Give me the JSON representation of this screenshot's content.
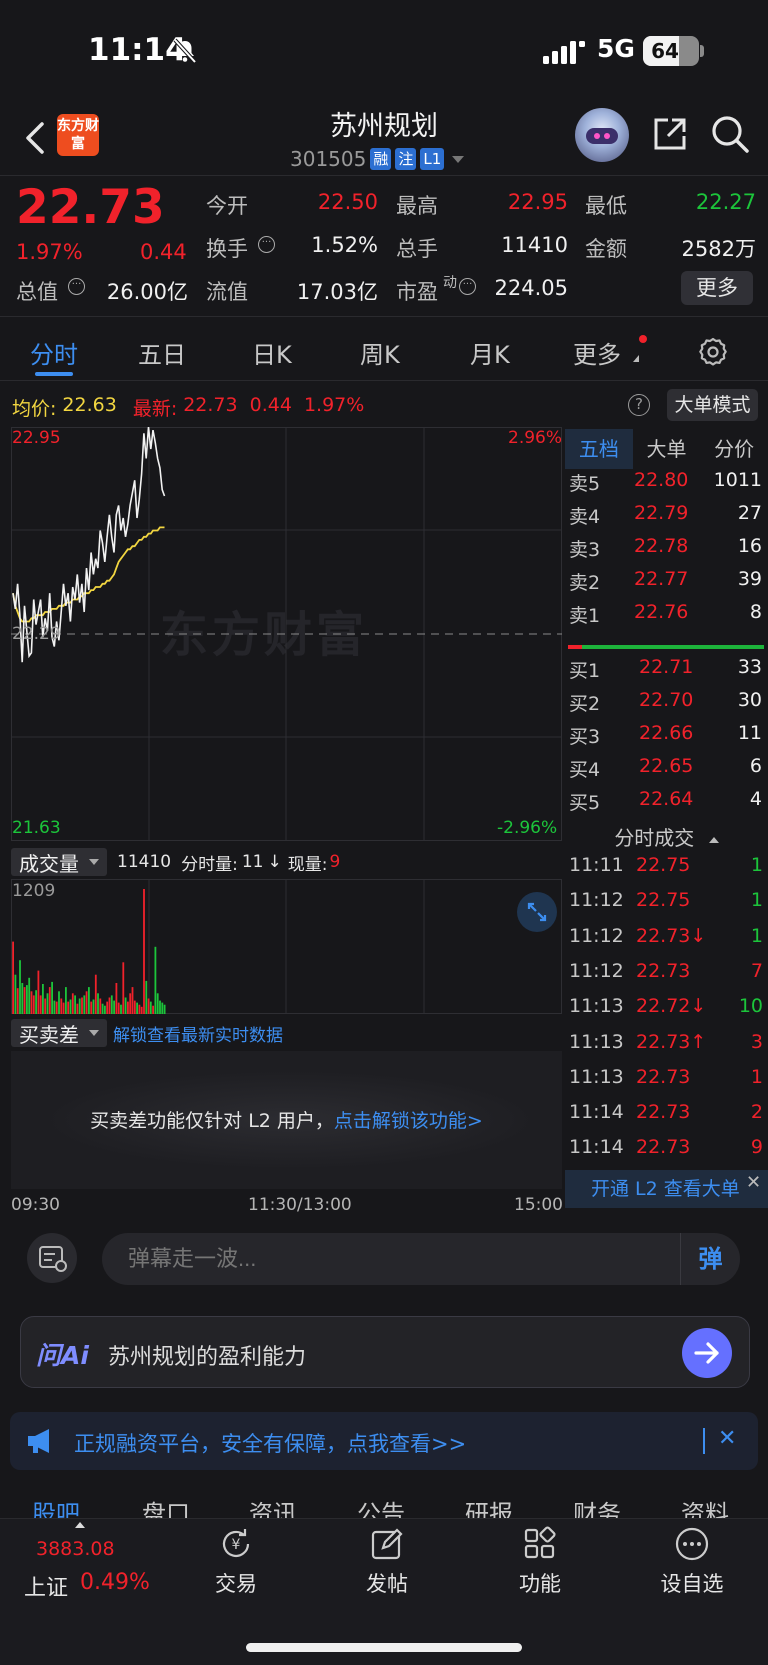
{
  "status": {
    "time": "11:14",
    "network": "5G",
    "battery": "64",
    "battery_level": 0.64
  },
  "header": {
    "logo_text": "东方财富",
    "name": "苏州规划",
    "code": "301505",
    "tags": [
      "融",
      "注",
      "L1"
    ]
  },
  "quote": {
    "price": "22.73",
    "change_pct": "1.97%",
    "change": "0.44",
    "fields": [
      {
        "k": "今开",
        "v": "22.50",
        "c": "red"
      },
      {
        "k": "最高",
        "v": "22.95",
        "c": "red"
      },
      {
        "k": "最低",
        "v": "22.27",
        "c": "green"
      },
      {
        "k": "换手",
        "v": "1.52%",
        "c": "white"
      },
      {
        "k": "总手",
        "v": "11410",
        "c": "white"
      },
      {
        "k": "金额",
        "v": "2582万",
        "c": "white"
      },
      {
        "k": "总值",
        "v": "26.00亿",
        "c": "white"
      },
      {
        "k": "流值",
        "v": "17.03亿",
        "c": "white"
      },
      {
        "k": "市盈",
        "v": "224.05",
        "c": "white"
      }
    ],
    "pe_sup": "动",
    "more": "更多"
  },
  "tabs": [
    "分时",
    "五日",
    "日K",
    "周K",
    "月K",
    "更多"
  ],
  "info": {
    "avg_label": "均价:",
    "avg": "22.63",
    "latest_label": "最新:",
    "latest": "22.73",
    "chg": "0.44",
    "pct": "1.97%",
    "big_mode": "大单模式"
  },
  "chart": {
    "watermark": "东方财富",
    "y_top": "22.95",
    "y_mid": "22.29",
    "y_bottom": "21.63",
    "pct_top": "2.96%",
    "pct_bottom": "-2.96%",
    "x_start": "09:30",
    "x_mid": "11:30/13:00",
    "x_end": "15:00"
  },
  "chart_data": {
    "type": "line",
    "series": [
      {
        "name": "最新",
        "values": [
          22.42,
          22.37,
          22.45,
          22.35,
          22.2,
          22.38,
          22.3,
          22.22,
          22.23,
          22.4,
          22.32,
          22.36,
          22.4,
          22.28,
          22.34,
          22.3,
          22.42,
          22.28,
          22.25,
          22.33,
          22.27,
          22.36,
          22.45,
          22.38,
          22.42,
          22.33,
          22.44,
          22.4,
          22.48,
          22.39,
          22.45,
          22.36,
          22.5,
          22.43,
          22.55,
          22.48,
          22.53,
          22.5,
          22.62,
          22.58,
          22.52,
          22.6,
          22.67,
          22.6,
          22.55,
          22.67,
          22.7,
          22.62,
          22.66,
          22.6,
          22.64,
          22.7,
          22.74,
          22.78,
          22.66,
          22.72,
          22.8,
          22.93,
          22.85,
          22.95,
          22.88,
          22.94,
          22.9,
          22.85,
          22.82,
          22.75,
          22.73
        ]
      },
      {
        "name": "均价",
        "values": [
          22.42,
          22.38,
          22.36,
          22.34,
          22.33,
          22.33,
          22.33,
          22.33,
          22.34,
          22.34,
          22.35,
          22.35,
          22.35,
          22.35,
          22.36,
          22.36,
          22.36,
          22.37,
          22.37,
          22.37,
          22.38,
          22.38,
          22.38,
          22.39,
          22.39,
          22.39,
          22.4,
          22.4,
          22.4,
          22.41,
          22.41,
          22.42,
          22.42,
          22.42,
          22.43,
          22.43,
          22.44,
          22.44,
          22.44,
          22.45,
          22.45,
          22.46,
          22.46,
          22.47,
          22.48,
          22.5,
          22.52,
          22.53,
          22.54,
          22.55,
          22.56,
          22.56,
          22.57,
          22.57,
          22.58,
          22.59,
          22.59,
          22.6,
          22.6,
          22.61,
          22.61,
          22.62,
          22.62,
          22.62,
          22.63,
          22.63,
          22.63
        ]
      }
    ],
    "volume": [
      700,
      380,
      250,
      520,
      300,
      260,
      280,
      350,
      220,
      180,
      230,
      420,
      180,
      290,
      150,
      200,
      260,
      310,
      130,
      120,
      220,
      150,
      110,
      260,
      120,
      140,
      200,
      180,
      100,
      150,
      160,
      180,
      220,
      260,
      120,
      140,
      380,
      200,
      150,
      100,
      80,
      120,
      160,
      180,
      130,
      300,
      110,
      90,
      500,
      160,
      120,
      200,
      260,
      130,
      110,
      90,
      70,
      1209,
      320,
      150,
      120,
      80,
      650,
      200,
      130,
      110,
      90
    ],
    "volume_colors": "mixed red/green",
    "ylim": [
      21.63,
      22.95
    ],
    "volume_max": 1209
  },
  "volume": {
    "label": "成交量",
    "total": "11410",
    "fen_label": "分时量:",
    "fen": "11",
    "arrow": "↓",
    "now_label": "现量:",
    "now": "9",
    "max": "1209"
  },
  "diff": {
    "label": "买卖差",
    "unlock": "解锁查看最新实时数据",
    "note": "买卖差功能仅针对 L2 用户，",
    "link": "点击解锁该功能>"
  },
  "orderbook": {
    "tabs": [
      "五档",
      "大单",
      "分价"
    ],
    "asks": [
      {
        "k": "卖5",
        "p": "22.80",
        "v": "1011"
      },
      {
        "k": "卖4",
        "p": "22.79",
        "v": "27"
      },
      {
        "k": "卖3",
        "p": "22.78",
        "v": "16"
      },
      {
        "k": "卖2",
        "p": "22.77",
        "v": "39"
      },
      {
        "k": "卖1",
        "p": "22.76",
        "v": "8"
      }
    ],
    "bids": [
      {
        "k": "买1",
        "p": "22.71",
        "v": "33"
      },
      {
        "k": "买2",
        "p": "22.70",
        "v": "30"
      },
      {
        "k": "买3",
        "p": "22.66",
        "v": "11"
      },
      {
        "k": "买4",
        "p": "22.65",
        "v": "6"
      },
      {
        "k": "买5",
        "p": "22.64",
        "v": "4"
      }
    ]
  },
  "ticks": {
    "title": "分时成交",
    "rows": [
      {
        "t": "11:11",
        "p": "22.75",
        "v": "1",
        "vc": "green"
      },
      {
        "t": "11:12",
        "p": "22.75",
        "v": "1",
        "vc": "green"
      },
      {
        "t": "11:12",
        "p": "22.73↓",
        "v": "1",
        "vc": "green"
      },
      {
        "t": "11:12",
        "p": "22.73",
        "v": "7",
        "vc": "red"
      },
      {
        "t": "11:13",
        "p": "22.72↓",
        "v": "10",
        "vc": "green"
      },
      {
        "t": "11:13",
        "p": "22.73↑",
        "v": "3",
        "vc": "red"
      },
      {
        "t": "11:13",
        "p": "22.73",
        "v": "1",
        "vc": "red"
      },
      {
        "t": "11:14",
        "p": "22.73",
        "v": "2",
        "vc": "red"
      },
      {
        "t": "11:14",
        "p": "22.73",
        "v": "9",
        "vc": "red"
      }
    ],
    "l2": "开通 L2 查看大单",
    "close": "✕"
  },
  "danmu": {
    "placeholder": "弹幕走一波...",
    "button": "弹"
  },
  "ai": {
    "logo": "问Ai",
    "text": "苏州规划的盈利能力"
  },
  "promo": {
    "text": "正规融资平台，安全有保障，点我查看>>",
    "close": "✕"
  },
  "bottom_tabs": [
    "股吧",
    "盘口",
    "资讯",
    "公告",
    "研报",
    "财务",
    "资料"
  ],
  "tabbar": {
    "index_value": "3883.08",
    "index_name": "上证",
    "index_pct": "0.49%",
    "items": [
      "交易",
      "发帖",
      "功能",
      "设自选"
    ]
  }
}
